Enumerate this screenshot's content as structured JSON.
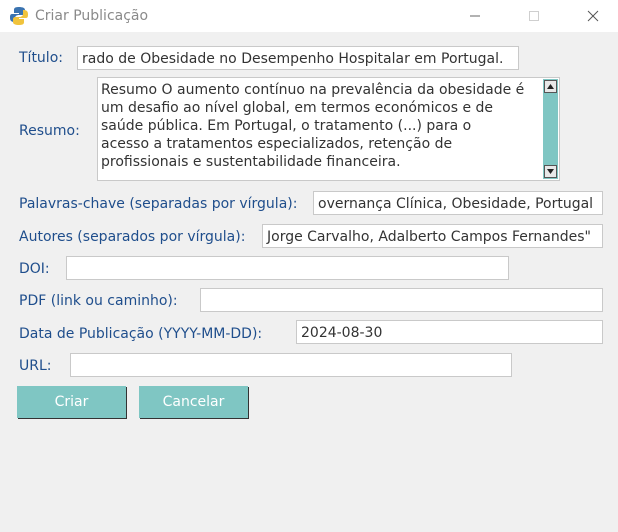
{
  "window": {
    "title": "Criar Publicação",
    "app_icon": "python-icon"
  },
  "form": {
    "titulo": {
      "label": "Título:",
      "value": "rado de Obesidade no Desempenho Hospitalar em Portugal."
    },
    "resumo": {
      "label": "Resumo:",
      "value": "Resumo O aumento contínuo na prevalência da obesidade é\num desafio ao nível global, em termos económicos e de\nsaúde pública. Em Portugal, o tratamento (...) para o\nacesso a tratamentos especializados, retenção de\nprofissionais e sustentabilidade financeira."
    },
    "palavras_chave": {
      "label": "Palavras-chave (separadas por vírgula):",
      "value": "overnança Clínica, Obesidade, Portugal"
    },
    "autores": {
      "label": "Autores (separados por vírgula):",
      "value": "Jorge Carvalho, Adalberto Campos Fernandes\""
    },
    "doi": {
      "label": "DOI:",
      "value": ""
    },
    "pdf": {
      "label": "PDF (link ou caminho):",
      "value": ""
    },
    "data_publicacao": {
      "label": "Data de Publicação (YYYY-MM-DD):",
      "value": "2024-08-30"
    },
    "url": {
      "label": "URL:",
      "value": ""
    }
  },
  "buttons": {
    "criar": "Criar",
    "cancelar": "Cancelar"
  },
  "colors": {
    "label": "#1f4e8c",
    "button_bg": "#7fc6c3",
    "window_bg": "#f0f0f0"
  }
}
